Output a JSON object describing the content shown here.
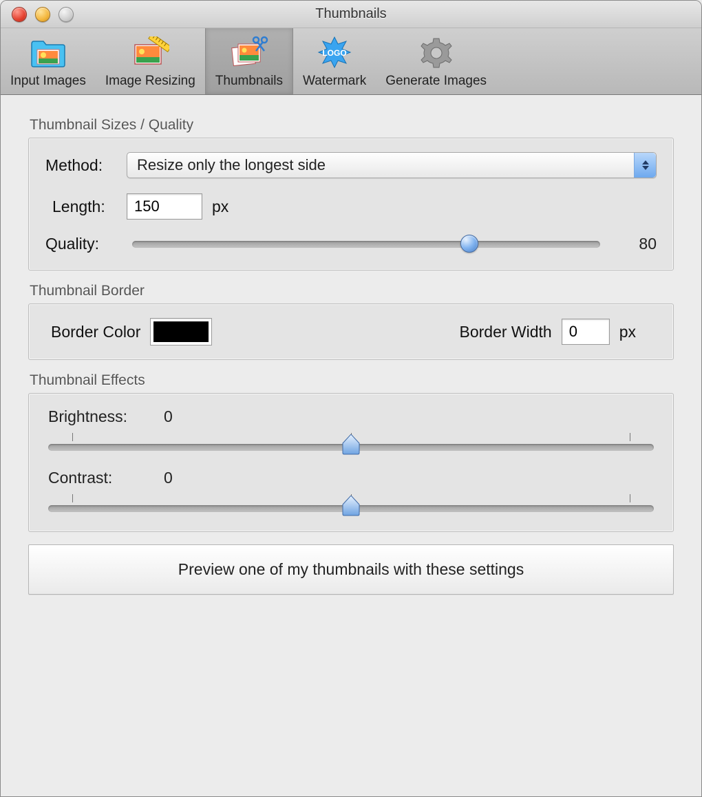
{
  "window": {
    "title": "Thumbnails"
  },
  "toolbar": {
    "items": [
      {
        "label": "Input Images"
      },
      {
        "label": "Image Resizing"
      },
      {
        "label": "Thumbnails"
      },
      {
        "label": "Watermark"
      },
      {
        "label": "Generate Images"
      }
    ],
    "active_index": 2
  },
  "sections": {
    "sizes": {
      "title": "Thumbnail Sizes / Quality",
      "method_label": "Method:",
      "method_value": "Resize only the longest side",
      "length_label": "Length:",
      "length_value": "150",
      "length_unit": "px",
      "quality_label": "Quality:",
      "quality_value": "80",
      "quality_percent": 80
    },
    "border": {
      "title": "Thumbnail Border",
      "color_label": "Border Color",
      "color_value": "#000000",
      "width_label": "Border Width",
      "width_value": "0",
      "width_unit": "px"
    },
    "effects": {
      "title": "Thumbnail Effects",
      "brightness_label": "Brightness:",
      "brightness_value": "0",
      "brightness_percent": 50,
      "contrast_label": "Contrast:",
      "contrast_value": "0",
      "contrast_percent": 50
    }
  },
  "preview_button": "Preview one of my thumbnails with these settings"
}
